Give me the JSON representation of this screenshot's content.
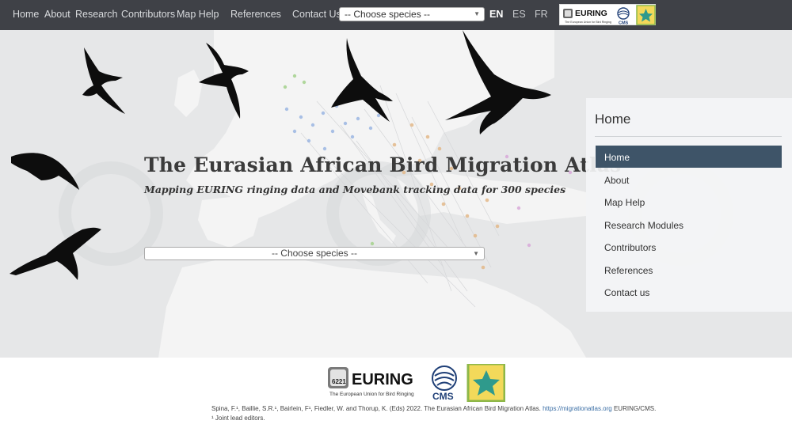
{
  "nav": {
    "links": [
      "Home",
      "About",
      "Research",
      "Contributors",
      "Map Help",
      "References",
      "Contact Us"
    ],
    "species_select": "-- Choose species --",
    "languages": [
      "EN",
      "ES",
      "FR"
    ],
    "active_language": "EN"
  },
  "logos": {
    "euring": "EURING",
    "euring_tagline": "The European Union for Bird Ringing",
    "euring_badge": "6221",
    "cms": "CMS"
  },
  "hero": {
    "title": "The Eurasian African Bird Migration Atlas",
    "subtitle": "Mapping EURING ringing data and Movebank tracking data for 300 species",
    "species_select": "-- Choose species --"
  },
  "side_menu": {
    "title": "Home",
    "items": [
      "Home",
      "About",
      "Map Help",
      "Research Modules",
      "Contributors",
      "References",
      "Contact us"
    ],
    "active": "Home"
  },
  "footer": {
    "citation": "Spina, F.¹, Baillie, S.R.¹, Bairlein, F¹, Fiedler, W. and Thorup, K. (Eds) 2022.  The Eurasian African Bird Migration Atlas.",
    "link": "https://migrationatlas.org",
    "org": "EURING/CMS.",
    "note": "¹ Joint lead editors."
  },
  "colors": {
    "nav_bg": "#3f4147",
    "active_menu_bg": "#3e5468",
    "map_bg": "#e6e7e8",
    "land": "#f4f4f4",
    "bird": "#0d0d0d"
  }
}
